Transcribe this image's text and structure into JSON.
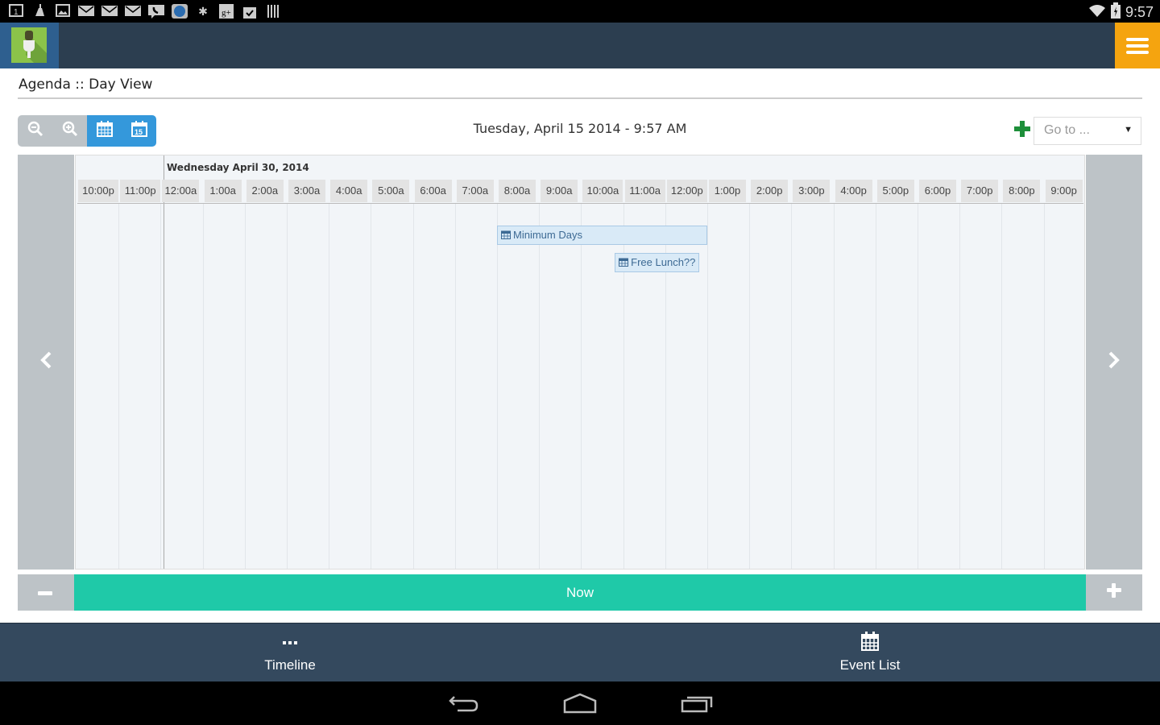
{
  "status_bar": {
    "notification_icons": [
      "calendar-1-icon",
      "cleaner-icon",
      "gallery-icon",
      "mail-icon",
      "mail-icon",
      "mail-icon",
      "voicemail-icon",
      "app-icon",
      "yelp-icon",
      "google-plus-icon",
      "shopping-bag-icon",
      "barcode-icon"
    ],
    "time": "9:57"
  },
  "app_bar": {
    "logo": "microphone-logo",
    "menu_icon": "hamburger-icon",
    "menu_color": "#f5a40f"
  },
  "page": {
    "title": "Agenda :: Day View",
    "current_datetime": "Tuesday, April 15 2014 - 9:57 AM"
  },
  "toolbar": {
    "buttons": [
      {
        "name": "zoom-out",
        "icon": "zoom-out-icon"
      },
      {
        "name": "zoom-in",
        "icon": "zoom-in-icon"
      },
      {
        "name": "month-view",
        "icon": "calendar-grid-icon"
      },
      {
        "name": "day-view",
        "icon": "calendar-15-icon",
        "label": "15"
      }
    ],
    "add_icon": "plus-icon",
    "goto_placeholder": "Go to ..."
  },
  "timeline": {
    "day_label": "Wednesday April 30, 2014",
    "hours": [
      "10:00p",
      "11:00p",
      "12:00a",
      "1:00a",
      "2:00a",
      "3:00a",
      "4:00a",
      "5:00a",
      "6:00a",
      "7:00a",
      "8:00a",
      "9:00a",
      "10:00a",
      "11:00a",
      "12:00p",
      "1:00p",
      "2:00p",
      "3:00p",
      "4:00p",
      "5:00p",
      "6:00p",
      "7:00p",
      "8:00p",
      "9:00p"
    ],
    "events": [
      {
        "title": "Minimum Days",
        "start_hour_index": 10,
        "end_hour_index": 15,
        "row": 0
      },
      {
        "title": "Free Lunch?? ",
        "start_hour_index": 12.8,
        "end_hour_index": 14.8,
        "row": 1
      }
    ],
    "prev_icon": "chevron-left-icon",
    "next_icon": "chevron-right-icon"
  },
  "controls": {
    "zoom_out_icon": "minus-icon",
    "now_label": "Now",
    "zoom_in_icon": "plus-icon"
  },
  "bottom_nav": {
    "items": [
      {
        "label": "Timeline",
        "icon": "ellipsis-icon"
      },
      {
        "label": "Event List",
        "icon": "calendar-icon"
      }
    ]
  },
  "system_nav": {
    "buttons": [
      "back",
      "home",
      "recents"
    ]
  }
}
